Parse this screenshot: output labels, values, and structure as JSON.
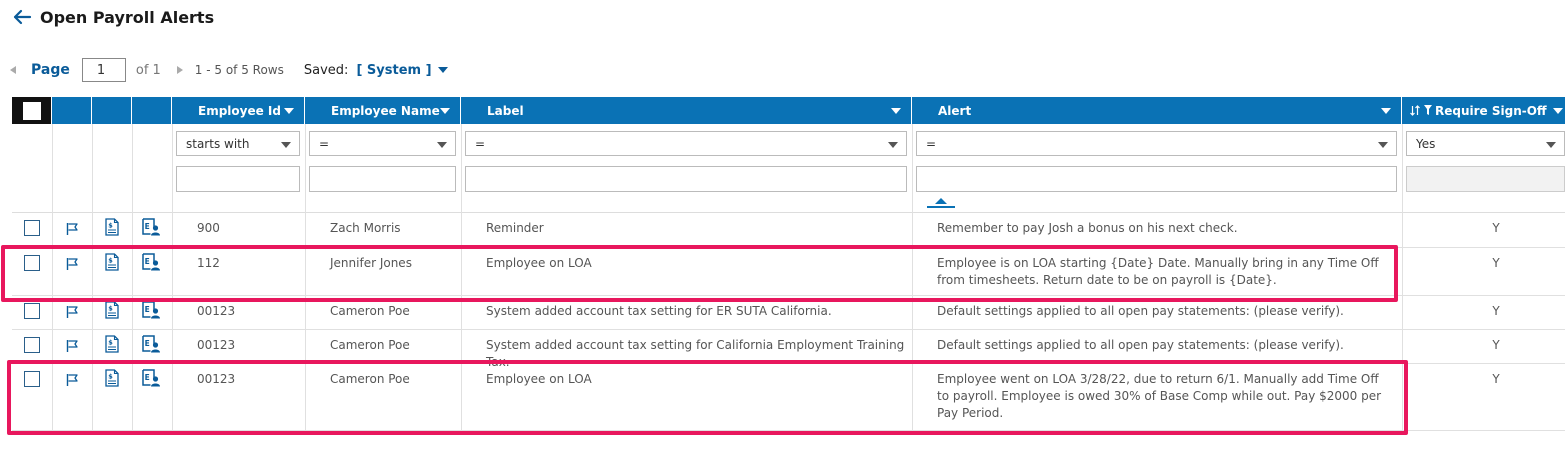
{
  "page": {
    "title": "Open Payroll Alerts"
  },
  "pager": {
    "page_label": "Page",
    "page_value": "1",
    "of_text": "of 1",
    "rows_text": "1 - 5 of 5 Rows",
    "saved_label": "Saved:",
    "saved_value": "[ System ]"
  },
  "columns": {
    "employee_id": "Employee Id",
    "employee_name": "Employee Name",
    "label": "Label",
    "alert": "Alert",
    "require_signoff": "Require Sign-Off"
  },
  "filters": {
    "employee_id_op": "starts with",
    "employee_name_op": "=",
    "label_op": "=",
    "alert_op": "=",
    "require_signoff_value": "Yes"
  },
  "rows": [
    {
      "employee_id": "900",
      "employee_name": "Zach Morris",
      "label": "Reminder",
      "alert": "Remember to pay Josh a bonus on his next check.",
      "signoff": "Y"
    },
    {
      "employee_id": "112",
      "employee_name": "Jennifer Jones",
      "label": "Employee on LOA",
      "alert": "Employee is on LOA starting {Date} Date. Manually bring in any Time Off from timesheets. Return date to be on payroll is {Date}.",
      "signoff": "Y"
    },
    {
      "employee_id": "00123",
      "employee_name": "Cameron Poe",
      "label": "System added account tax setting for ER SUTA California.",
      "alert": "Default settings applied to all open pay statements: (please verify).",
      "signoff": "Y"
    },
    {
      "employee_id": "00123",
      "employee_name": "Cameron Poe",
      "label": "System added account tax setting for California Employment Training Tax.",
      "alert": "Default settings applied to all open pay statements: (please verify).",
      "signoff": "Y"
    },
    {
      "employee_id": "00123",
      "employee_name": "Cameron Poe",
      "label": "Employee on LOA",
      "alert": "Employee went on LOA 3/28/22, due to return 6/1. Manually add Time Off to payroll. Employee is owed 30% of Base Comp while out. Pay $2000 per Pay Period.",
      "signoff": "Y"
    }
  ],
  "icons": {
    "back": "arrow-left-icon",
    "flag": "flag-icon",
    "statement": "pay-statement-icon",
    "employee": "employee-profile-icon",
    "sort": "sort-icon",
    "filter": "filter-icon"
  },
  "colors": {
    "header_blue": "#0a72b5",
    "link_blue": "#0a5b99",
    "highlight": "#e8175d"
  }
}
